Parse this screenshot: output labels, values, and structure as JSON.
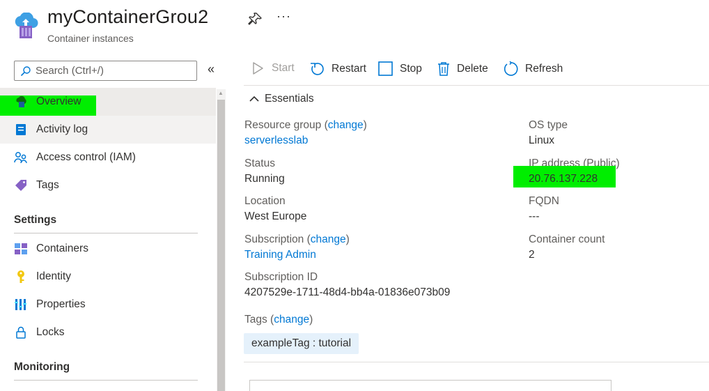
{
  "header": {
    "title": "myContainerGrou2",
    "subtitle": "Container instances",
    "pin_icon": "pin-icon",
    "more_label": "···"
  },
  "sidebar": {
    "search_placeholder": "Search (Ctrl+/)",
    "collapse_label": "«",
    "items": [
      {
        "label": "Overview",
        "icon": "overview-icon"
      },
      {
        "label": "Activity log",
        "icon": "activity-log-icon"
      },
      {
        "label": "Access control (IAM)",
        "icon": "iam-icon"
      },
      {
        "label": "Tags",
        "icon": "tag-icon"
      }
    ],
    "sections": [
      {
        "title": "Settings",
        "items": [
          {
            "label": "Containers",
            "icon": "containers-icon"
          },
          {
            "label": "Identity",
            "icon": "identity-icon"
          },
          {
            "label": "Properties",
            "icon": "properties-icon"
          },
          {
            "label": "Locks",
            "icon": "lock-icon"
          }
        ]
      },
      {
        "title": "Monitoring",
        "items": []
      }
    ]
  },
  "toolbar": {
    "start": "Start",
    "restart": "Restart",
    "stop": "Stop",
    "delete": "Delete",
    "refresh": "Refresh"
  },
  "essentials": {
    "title": "Essentials",
    "resource_group": {
      "label": "Resource group",
      "change": "change",
      "value": "serverlesslab"
    },
    "status": {
      "label": "Status",
      "value": "Running"
    },
    "location": {
      "label": "Location",
      "value": "West Europe"
    },
    "subscription": {
      "label": "Subscription",
      "change": "change",
      "value": "Training Admin"
    },
    "subscription_id": {
      "label": "Subscription ID",
      "value": "4207529e-1711-48d4-bb4a-01836e073b09"
    },
    "os_type": {
      "label": "OS type",
      "value": "Linux"
    },
    "ip_address": {
      "label": "IP address (Public)",
      "value": "20.76.137.228"
    },
    "fqdn": {
      "label": "FQDN",
      "value": "---"
    },
    "container_count": {
      "label": "Container count",
      "value": "2"
    },
    "tags": {
      "label": "Tags",
      "change": "change",
      "value": "exampleTag : tutorial"
    }
  },
  "colors": {
    "accent": "#0078d4",
    "highlight": "#00ee00"
  }
}
